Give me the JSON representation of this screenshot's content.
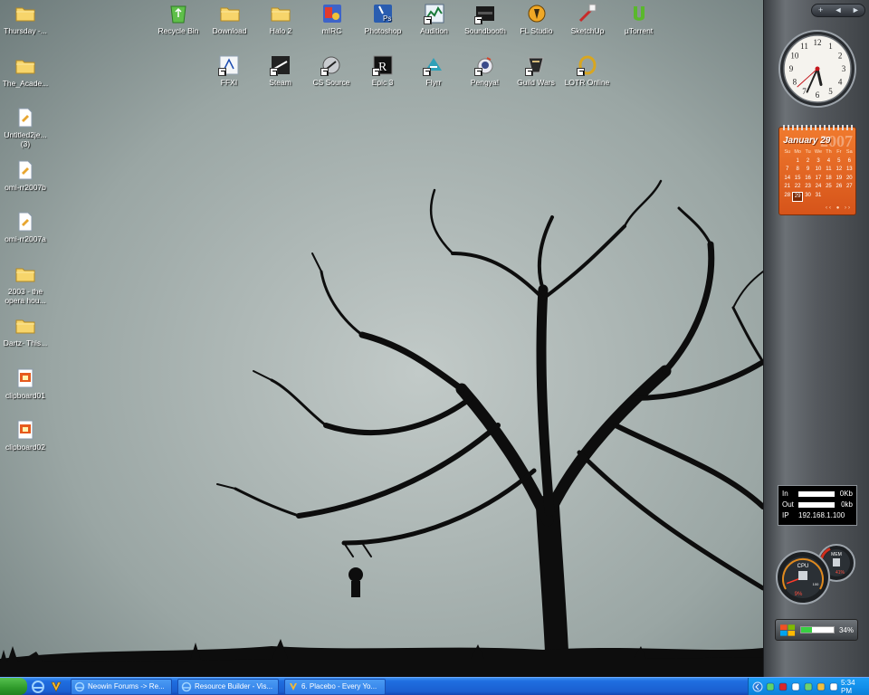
{
  "desktop": {
    "left_icons": [
      {
        "label": "Thursday -...",
        "icon": "folder-icon"
      },
      {
        "label": "The_Acade...",
        "icon": "folder-icon"
      },
      {
        "label": "Untitled2je...",
        "label2": "(3)",
        "icon": "document-icon"
      },
      {
        "label": "omi-rr2007b",
        "icon": "document-icon"
      },
      {
        "label": "omi-rr2007a",
        "icon": "document-icon"
      },
      {
        "label": "2003 - the",
        "label2": "opera hou...",
        "icon": "folder-icon"
      },
      {
        "label": "Dartz- This...",
        "icon": "folder-icon"
      },
      {
        "label": "clipboard01",
        "icon": "image-icon"
      },
      {
        "label": "clipboard02",
        "icon": "image-icon"
      }
    ],
    "top_row1": [
      {
        "label": "Recycle Bin",
        "icon": "recycle-bin-icon"
      },
      {
        "label": "Download",
        "icon": "folder-icon"
      },
      {
        "label": "Halo 2",
        "icon": "folder-icon"
      },
      {
        "label": "mIRC",
        "icon": "mirc-icon"
      },
      {
        "label": "Photoshop",
        "icon": "photoshop-icon"
      },
      {
        "label": "Audition",
        "icon": "audition-icon"
      },
      {
        "label": "Soundbooth",
        "icon": "soundbooth-icon"
      },
      {
        "label": "FL Studio",
        "icon": "fl-studio-icon"
      },
      {
        "label": "SketchUp",
        "icon": "sketchup-icon"
      },
      {
        "label": "µTorrent",
        "icon": "utorrent-icon"
      }
    ],
    "top_row2": [
      {
        "label": "FFXI",
        "icon": "ffxi-icon"
      },
      {
        "label": "Steam",
        "icon": "steam-icon"
      },
      {
        "label": "CS Source",
        "icon": "cs-source-icon"
      },
      {
        "label": "Epic 3",
        "icon": "epic-icon"
      },
      {
        "label": "Flyrr",
        "icon": "flyrr-icon"
      },
      {
        "label": "Pengya!",
        "icon": "pengya-icon"
      },
      {
        "label": "Guild Wars",
        "icon": "guild-wars-icon"
      },
      {
        "label": "LOTR Online",
        "icon": "lotr-online-icon"
      }
    ]
  },
  "sidebar": {
    "controls": [
      "+",
      "◄",
      "►"
    ],
    "calendar": {
      "month_label": "January 29",
      "year": "2007",
      "days_of_week": [
        "Su",
        "Mo",
        "Tu",
        "We",
        "Th",
        "Fr",
        "Sa"
      ],
      "weeks": [
        [
          "",
          "1",
          "2",
          "3",
          "4",
          "5",
          "6"
        ],
        [
          "7",
          "8",
          "9",
          "10",
          "11",
          "12",
          "13"
        ],
        [
          "14",
          "15",
          "16",
          "17",
          "18",
          "19",
          "20"
        ],
        [
          "21",
          "22",
          "23",
          "24",
          "25",
          "26",
          "27"
        ],
        [
          "28",
          "29",
          "30",
          "31",
          "",
          "",
          ""
        ]
      ],
      "today": "29",
      "nav": "‹‹ ● ››"
    },
    "clock": {
      "hour": 5,
      "minute": 34,
      "second": 38
    },
    "network": {
      "in_label": "In",
      "in_value": "0Kb",
      "out_label": "Out",
      "out_value": "0kb",
      "ip_label": "IP",
      "ip_value": "192.168.1.100"
    },
    "cpu": {
      "label": "CPU",
      "value": "9%",
      "fraction": 0.09,
      "max_label": "100"
    },
    "mem": {
      "label": "MEM",
      "value": "41%",
      "fraction": 0.41
    },
    "battery": {
      "value": "34%",
      "fraction": 0.34
    }
  },
  "taskbar": {
    "quick_launch": [
      "ie-icon",
      "winamp-icon"
    ],
    "tasks": [
      {
        "label": "Neowin Forums -> Re...",
        "icon": "ie-icon"
      },
      {
        "label": "Resource Builder - Vis...",
        "icon": "ie-icon"
      },
      {
        "label": "6. Placebo - Every Yo...",
        "icon": "winamp-icon"
      }
    ],
    "tray_icons": [
      "back-arrow-icon",
      "network-icon",
      "antivirus-icon",
      "speaker-icon",
      "messenger-icon",
      "shield-icon",
      "mail-icon"
    ],
    "clock": "5:34 PM"
  },
  "colors": {
    "accent_orange": "#e2661f",
    "taskbar_blue": "#1f6ee0",
    "tree_black": "#0d0d0d"
  }
}
